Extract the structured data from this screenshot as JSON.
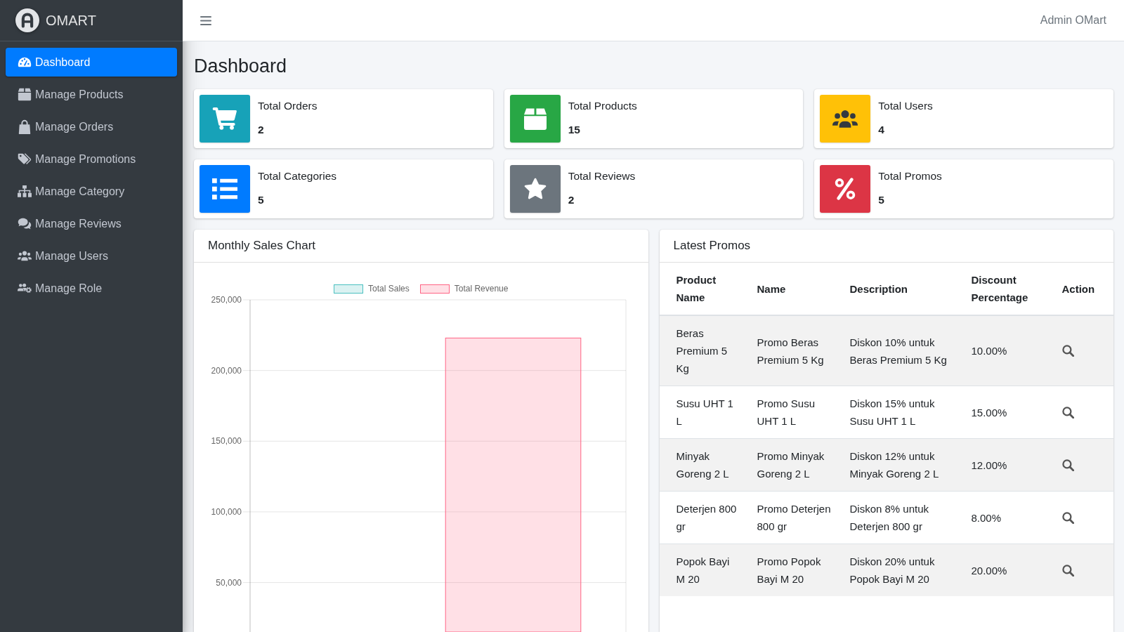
{
  "sidebar": {
    "brand": "OMART",
    "items": [
      {
        "label": "Dashboard",
        "selected": true
      },
      {
        "label": "Manage Products",
        "selected": false
      },
      {
        "label": "Manage Orders",
        "selected": false
      },
      {
        "label": "Manage Promotions",
        "selected": false
      },
      {
        "label": "Manage Category",
        "selected": false
      },
      {
        "label": "Manage Reviews",
        "selected": false
      },
      {
        "label": "Manage Users",
        "selected": false
      },
      {
        "label": "Manage Role",
        "selected": false
      }
    ]
  },
  "navbar": {
    "user": "Admin OMart"
  },
  "page_title": "Dashboard",
  "stats": [
    {
      "title": "Total Orders",
      "value": "2",
      "color": "#17a2b8"
    },
    {
      "title": "Total Products",
      "value": "15",
      "color": "#28a745"
    },
    {
      "title": "Total Users",
      "value": "4",
      "color": "#ffc107"
    },
    {
      "title": "Total Categories",
      "value": "5",
      "color": "#007bff"
    },
    {
      "title": "Total Reviews",
      "value": "2",
      "color": "#6c757d"
    },
    {
      "title": "Total Promos",
      "value": "5",
      "color": "#dc3545"
    }
  ],
  "sales_chart": {
    "title": "Monthly Sales Chart",
    "chart_data": {
      "type": "bar",
      "series": [
        {
          "name": "Total Sales",
          "color": "#4bc0c0",
          "values": [
            null
          ]
        },
        {
          "name": "Total Revenue",
          "color": "#ff6384",
          "values": [
            223000
          ]
        }
      ],
      "ylim": [
        15000,
        250000
      ],
      "yticks": [
        {
          "value": 50000,
          "label": "50,000"
        },
        {
          "value": 100000,
          "label": "100,000"
        },
        {
          "value": 150000,
          "label": "150,000"
        },
        {
          "value": 200000,
          "label": "200,000"
        },
        {
          "value": 250000,
          "label": "250,000"
        }
      ],
      "grid": true
    }
  },
  "latest_promos": {
    "title": "Latest Promos",
    "columns": [
      "Product Name",
      "Name",
      "Description",
      "Discount Percentage",
      "Action"
    ],
    "rows": [
      {
        "product_name": "Beras Premium 5 Kg",
        "name": "Promo Beras Premium 5 Kg",
        "description": "Diskon 10% untuk Beras Premium 5 Kg",
        "discount_percentage": "10.00%"
      },
      {
        "product_name": "Susu UHT 1 L",
        "name": "Promo Susu UHT 1 L",
        "description": "Diskon 15% untuk Susu UHT 1 L",
        "discount_percentage": "15.00%"
      },
      {
        "product_name": "Minyak Goreng 2 L",
        "name": "Promo Minyak Goreng 2 L",
        "description": "Diskon 12% untuk Minyak Goreng 2 L",
        "discount_percentage": "12.00%"
      },
      {
        "product_name": "Deterjen 800 gr",
        "name": "Promo Deterjen 800 gr",
        "description": "Diskon 8% untuk Deterjen 800 gr",
        "discount_percentage": "8.00%"
      },
      {
        "product_name": "Popok Bayi M 20",
        "name": "Promo Popok Bayi M 20",
        "description": "Diskon 20% untuk Popok Bayi M 20",
        "discount_percentage": "20.00%"
      }
    ]
  }
}
